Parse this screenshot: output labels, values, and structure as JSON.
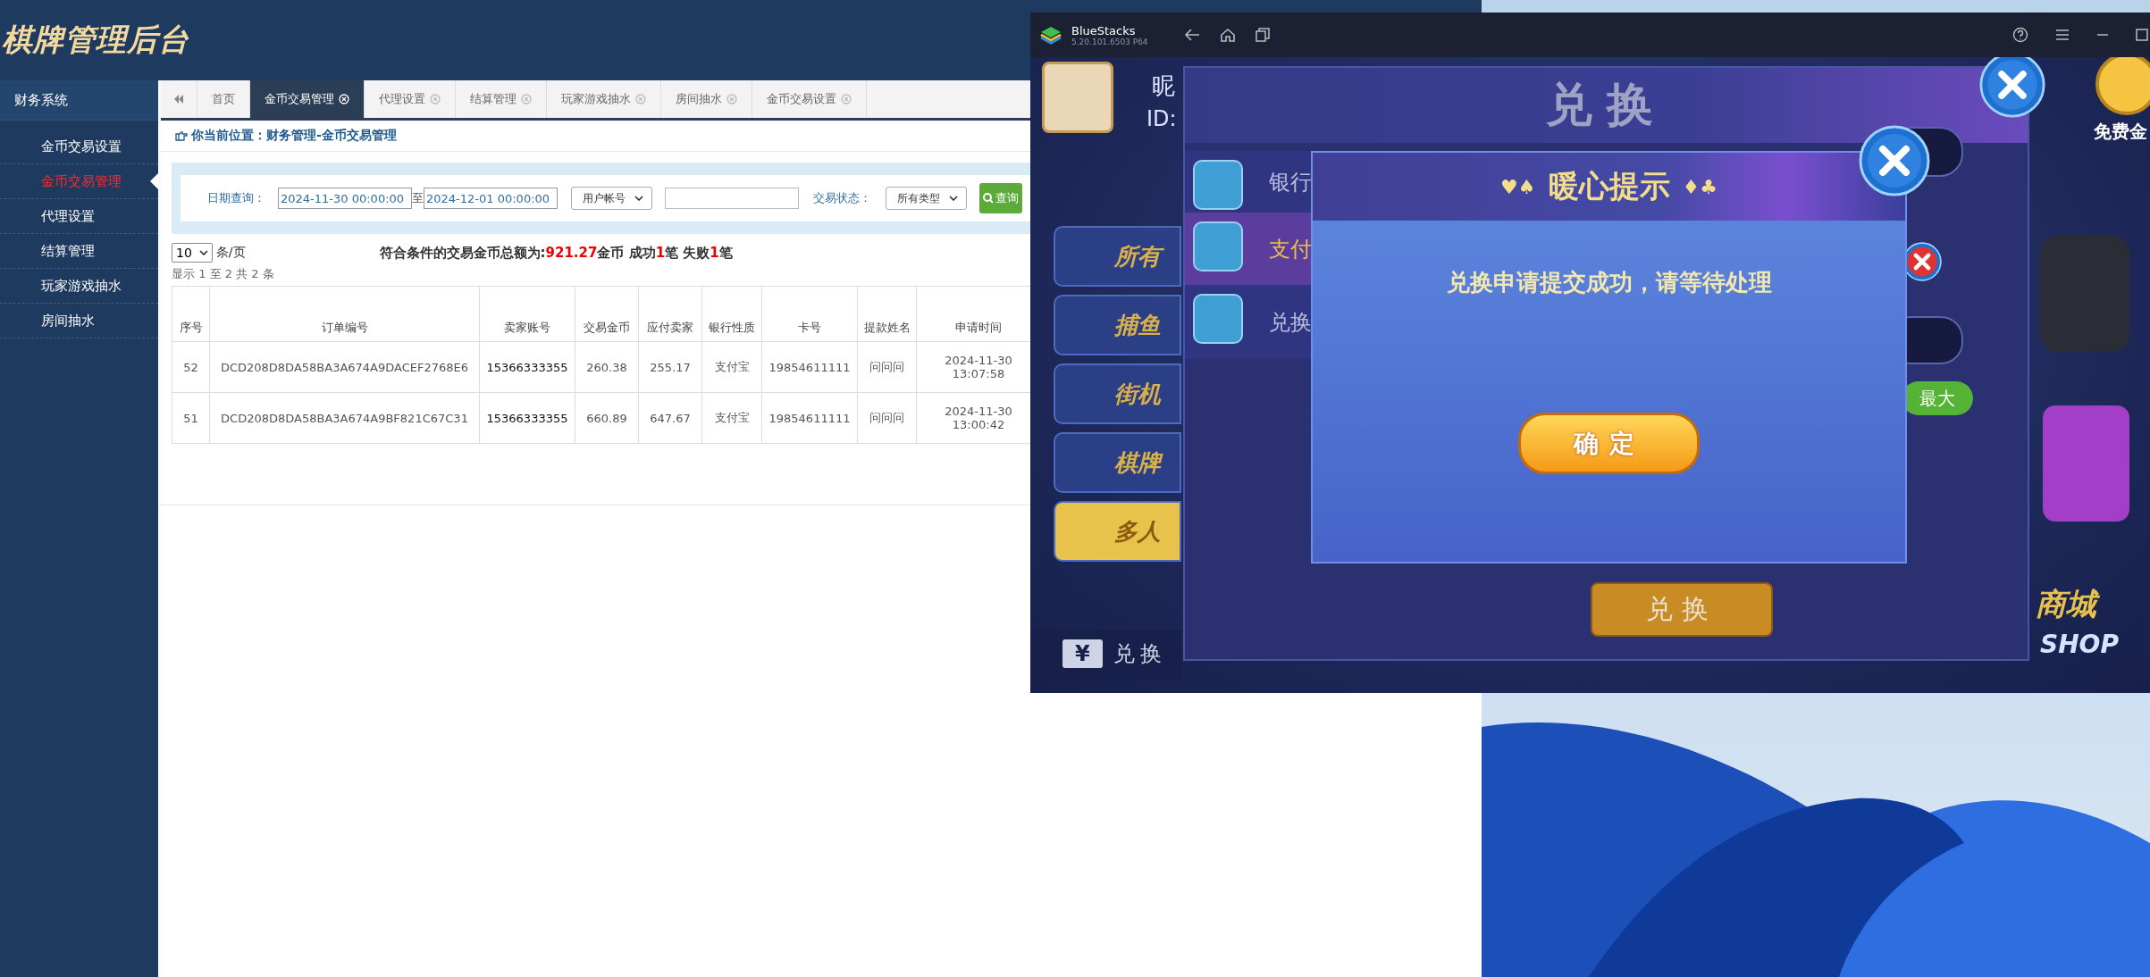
{
  "admin": {
    "logo": "棋牌管理后台",
    "sidebar": {
      "title": "财务系统",
      "items": [
        {
          "label": "金币交易设置",
          "selected": false
        },
        {
          "label": "金币交易管理",
          "selected": true
        },
        {
          "label": "代理设置",
          "selected": false
        },
        {
          "label": "结算管理",
          "selected": false
        },
        {
          "label": "玩家游戏抽水",
          "selected": false
        },
        {
          "label": "房间抽水",
          "selected": false
        }
      ]
    },
    "tabs": [
      {
        "label": "首页",
        "selected": false,
        "closable": false
      },
      {
        "label": "金币交易管理",
        "selected": true,
        "closable": true
      },
      {
        "label": "代理设置",
        "selected": false,
        "closable": true
      },
      {
        "label": "结算管理",
        "selected": false,
        "closable": true
      },
      {
        "label": "玩家游戏抽水",
        "selected": false,
        "closable": true
      },
      {
        "label": "房间抽水",
        "selected": false,
        "closable": true
      },
      {
        "label": "金币交易设置",
        "selected": false,
        "closable": true
      }
    ],
    "breadcrumb": "你当前位置：财务管理-金币交易管理",
    "filter": {
      "date_label": "日期查询：",
      "date_from": "2024-11-30 00:00:00",
      "separator": "至",
      "date_to": "2024-12-01 00:00:00",
      "account_type": "用户帐号",
      "status_label": "交易状态：",
      "status": "所有类型",
      "search_button": "查询"
    },
    "page_size": "10",
    "page_size_unit": "条/页",
    "summary": "符合条件的交易金币总额为:**921.27**金币 成功**1**笔 失败**1**笔",
    "info": "显示 1 至 2 共 2 条",
    "table": {
      "columns": [
        "序号",
        "订单编号",
        "卖家账号",
        "交易金币",
        "应付卖家",
        "银行性质",
        "卡号",
        "提款姓名",
        "申请时间"
      ],
      "rows": [
        [
          "52",
          "DCD208D8DA58BA3A674A9DACEF2768E6",
          "15366333355",
          "260.38",
          "255.17",
          "支付宝",
          "19854611111",
          "问问问",
          "2024-11-30 13:07:58"
        ],
        [
          "51",
          "DCD208D8DA58BA3A674A9BF821C67C31",
          "15366333355",
          "660.89",
          "647.67",
          "支付宝",
          "19854611111",
          "问问问",
          "2024-11-30 13:00:42"
        ]
      ]
    }
  },
  "emulator": {
    "title": "BlueStacks",
    "version": "5.20.101.6503 P64",
    "game": {
      "nickname_label": "昵",
      "id_label": "ID:",
      "free_coins": "免费金",
      "menu": [
        {
          "label": "所有",
          "selected": false
        },
        {
          "label": "捕鱼",
          "selected": false
        },
        {
          "label": "街机",
          "selected": false
        },
        {
          "label": "棋牌",
          "selected": false
        },
        {
          "label": "多人",
          "selected": true
        }
      ],
      "exchange_panel": {
        "title": "兑换",
        "tabs": [
          {
            "label": "银行",
            "selected": false
          },
          {
            "label": "支付",
            "selected": true
          },
          {
            "label": "兑换",
            "selected": false
          }
        ],
        "max_button": "最大",
        "exchange_button": "兑换"
      },
      "dialog": {
        "title_left": "♥♠",
        "title": "暖心提示",
        "title_right": "♦♣",
        "message": "兑换申请提交成功，请等待处理",
        "confirm": "确定"
      },
      "bottom_bar": {
        "currency": "¥",
        "exchange": "兑换",
        "shop": "商城",
        "shop_en": "SHOP"
      }
    }
  }
}
